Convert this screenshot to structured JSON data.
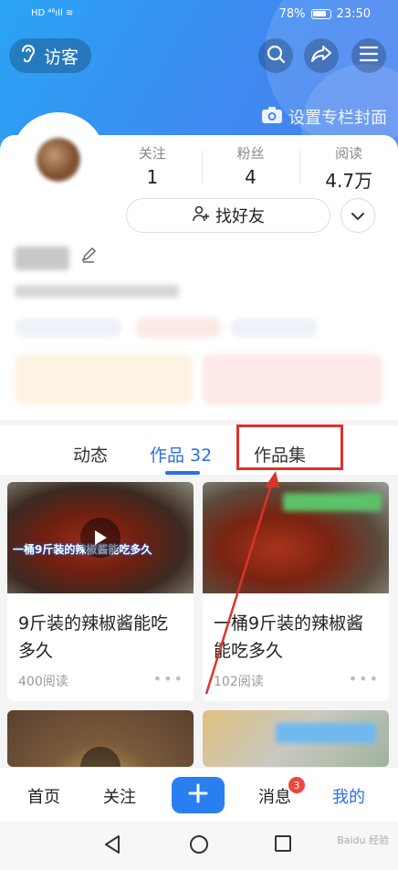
{
  "statusbar": {
    "left": "HD ⁴⁶ıll ≋",
    "battery": "78%",
    "time": "23:50"
  },
  "header": {
    "visitor_label": "访客",
    "cover_label": "设置专栏封面"
  },
  "stats": [
    {
      "label": "关注",
      "value": "1"
    },
    {
      "label": "粉丝",
      "value": "4"
    },
    {
      "label": "阅读",
      "value": "4.7万"
    }
  ],
  "profile": {
    "find_friends_label": "找好友"
  },
  "tabs": [
    {
      "label": "动态"
    },
    {
      "label": "作品 32"
    },
    {
      "label": "作品集"
    }
  ],
  "posts": [
    {
      "title": "9斤装的辣椒酱能吃多久",
      "reads": "400阅读",
      "thumb_caption": "一桶9斤装的辣椒酱能吃多久",
      "dots": "•••"
    },
    {
      "title": "一桶9斤装的辣椒酱能吃多久",
      "reads": "102阅读",
      "dots": "•••"
    }
  ],
  "bottom_nav": {
    "home": "首页",
    "follow": "关注",
    "messages": "消息",
    "messages_badge": "3",
    "mine": "我的"
  },
  "watermark": "Baidu 经验",
  "colors": {
    "accent": "#2a6df0",
    "header": "#3d8bf0",
    "highlight": "#d9342b",
    "badge": "#f0473c"
  }
}
